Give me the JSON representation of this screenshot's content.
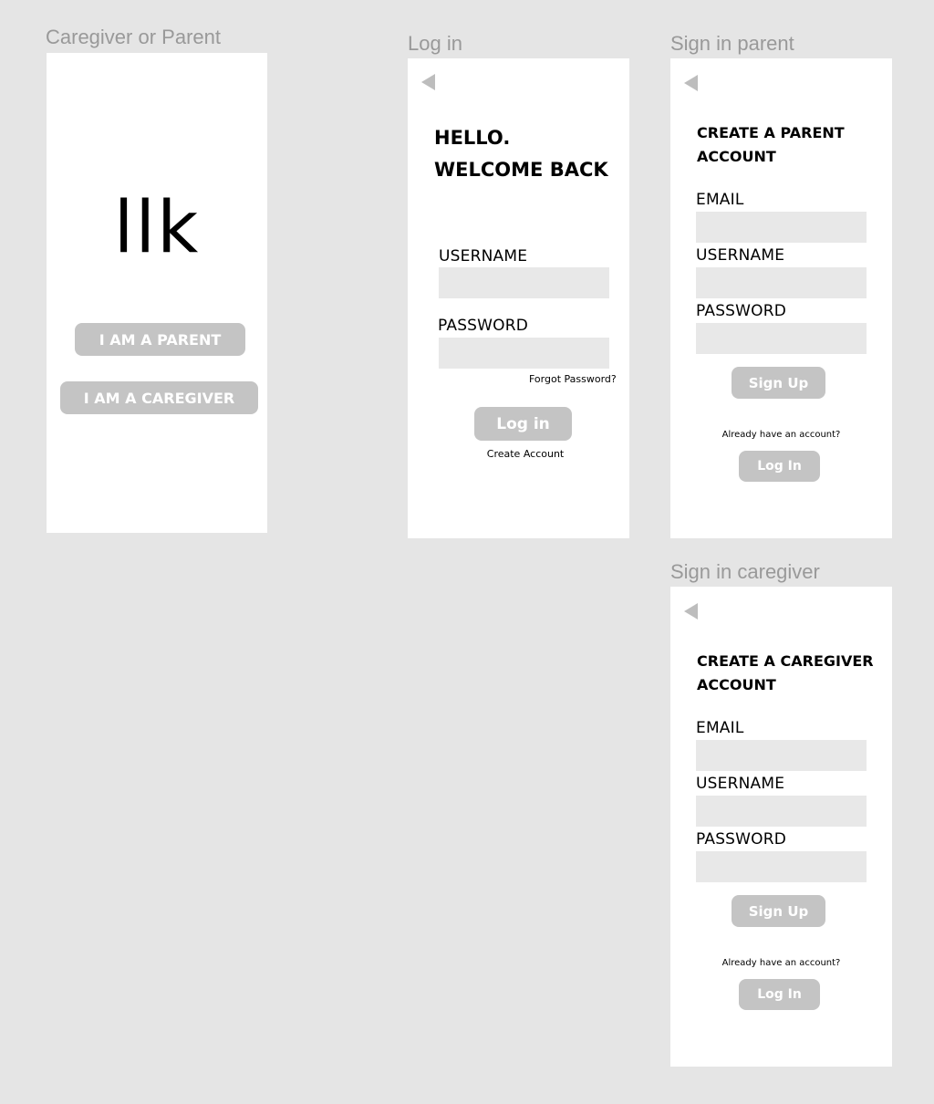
{
  "canvas_bg": "#e5e5e5",
  "colors": {
    "button": "#c4c4c4",
    "input": "#e8e8e8",
    "frame_label": "#999999",
    "back_icon": "#bdbdbd"
  },
  "frames": {
    "choose_role": {
      "label": "Caregiver or Parent",
      "logo": "llk",
      "parent_button": "I AM A PARENT",
      "caregiver_button": "I AM A CAREGIVER"
    },
    "login": {
      "label": "Log in",
      "back_icon": "back-arrow-icon",
      "heading_line1": "HELLO.",
      "heading_line2": "WELCOME BACK",
      "username_label": "USERNAME",
      "password_label": "PASSWORD",
      "forgot_password": "Forgot Password?",
      "login_button": "Log in",
      "create_account": "Create Account"
    },
    "signin_parent": {
      "label": "Sign in parent",
      "back_icon": "back-arrow-icon",
      "heading_line1": "CREATE A PARENT",
      "heading_line2": "ACCOUNT",
      "email_label": "EMAIL",
      "username_label": "USERNAME",
      "password_label": "PASSWORD",
      "signup_button": "Sign Up",
      "already_text": "Already have an account?",
      "login_button": "Log In"
    },
    "signin_caregiver": {
      "label": "Sign in caregiver",
      "back_icon": "back-arrow-icon",
      "heading_line1": "CREATE A CAREGIVER",
      "heading_line2": "ACCOUNT",
      "email_label": "EMAIL",
      "username_label": "USERNAME",
      "password_label": "PASSWORD",
      "signup_button": "Sign Up",
      "already_text": "Already have an account?",
      "login_button": "Log In"
    }
  }
}
